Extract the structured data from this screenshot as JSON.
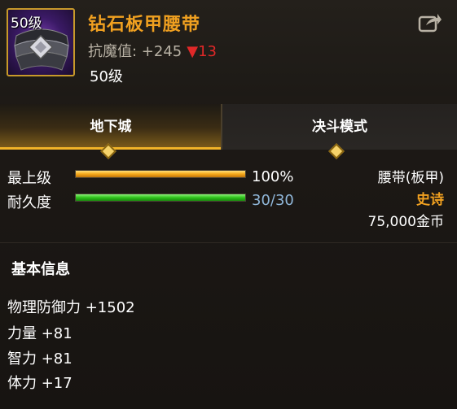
{
  "item": {
    "level_tag": "50级",
    "name": "钻石板甲腰带",
    "stat_text": "抗魔值: +245",
    "stat_change": "▼13",
    "required_level": "50级",
    "icon": "share-icon"
  },
  "tabs": [
    {
      "label": "地下城",
      "active": true
    },
    {
      "label": "决斗模式",
      "active": false
    }
  ],
  "bars": [
    {
      "label": "最上级",
      "value_text": "100%",
      "fraction": 1.0,
      "color": "#f5a81a"
    },
    {
      "label": "耐久度",
      "value_text": "30/30",
      "fraction": 1.0,
      "color": "#2ec21a"
    }
  ],
  "info": {
    "type": "腰带(板甲)",
    "rarity": "史诗",
    "price": "75,000金币"
  },
  "section": {
    "title": "基本信息",
    "attributes": [
      "物理防御力 +1502",
      "力量 +81",
      "智力 +81",
      "体力 +17"
    ]
  },
  "colors": {
    "name": "#f0a020",
    "rarity": "#f0a020",
    "decrease": "#e02828",
    "durability_text": "#8fb6d8"
  }
}
